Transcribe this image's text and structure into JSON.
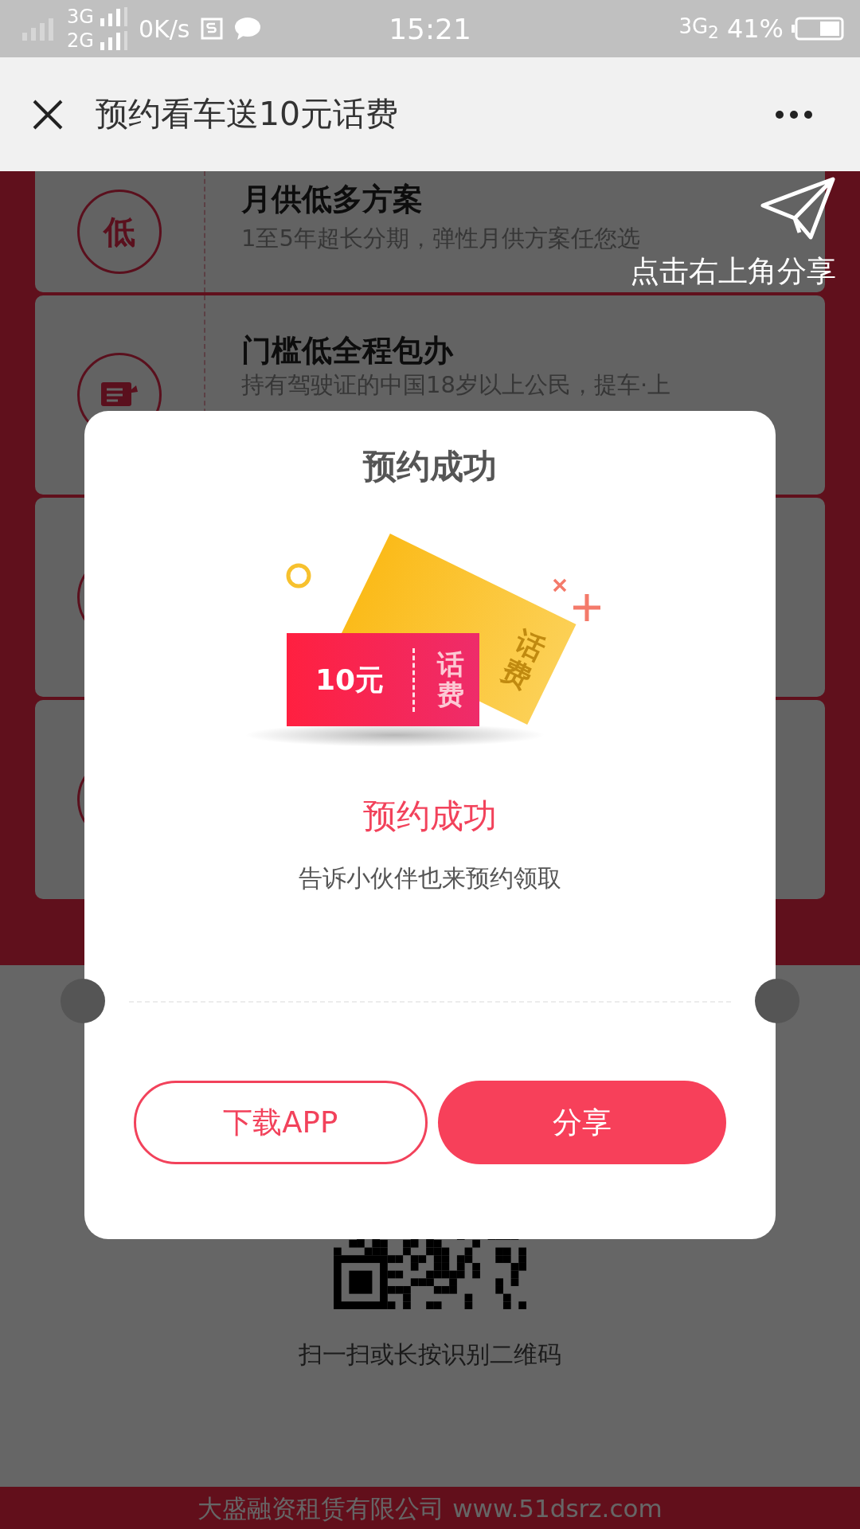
{
  "status_bar": {
    "network_top": "3G",
    "network_bottom": "2G",
    "speed": "0K/s",
    "time": "15:21",
    "mobile_data": "3G$_{2}$",
    "battery": "41%"
  },
  "nav": {
    "title": "预约看车送10元话费"
  },
  "features": [
    {
      "kind": "text",
      "icon_text": "低",
      "title": "月供低多方案",
      "desc": "1至5年超长分期，弹性月供方案任您选"
    },
    {
      "kind": "document",
      "title": "门槛低全程包办",
      "desc": "持有驾驶证的中国18岁以上公民，提车·上"
    },
    {
      "kind": "ring"
    },
    {
      "kind": "ring"
    }
  ],
  "share_hint": "点击右上角分享",
  "qr": {
    "caption": "扫一扫或长按识别二维码"
  },
  "footer": "大盛融资租赁有限公司 www.51dsrz.com",
  "modal": {
    "title": "预约成功",
    "coupon_amount": "10元",
    "coupon_label": "话费",
    "back_coupon_label": "话费",
    "heading": "预约成功",
    "message": "告诉小伙伴也来预约领取",
    "buttons": [
      {
        "label": "下载APP",
        "kind": "outline"
      },
      {
        "label": "分享",
        "kind": "filled"
      }
    ]
  }
}
